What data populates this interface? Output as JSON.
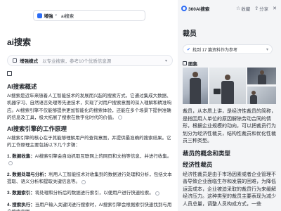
{
  "left": {
    "search": {
      "mode_label": "増強",
      "query": "ai搜索"
    },
    "page_title": "ai搜索",
    "mode": {
      "name": "增强模式",
      "description": "以专业搜索，参考10个优质信息源"
    },
    "article": {
      "h1": "AI搜索概述",
      "p1": "AI搜索是近年来随着人工智能技术的发展而兴起的搜索方式，它通过集成大数据、机器学习、自然语言处理等先进技术，实现了对用户搜索意图的深入理解和精准响应。AI搜索引擎不仅能够提供更加智能化的搜索体验，还能在多个场景下提供准确的信息及工具，极大拓展了搜索在数字化时代的价值。",
      "h2": "AI搜索引擎的工作原理",
      "p2": "AI搜索引擎的核心在于其能够理解用户的查询意图，并提供最准确的搜索结果。它的工作原理主要包括以下几个步骤：",
      "steps": [
        {
          "term": "1. 数据收集：",
          "text": "AI搜索引擎会自动抓取互联网上的网页和文档等信息，并进行收集。"
        },
        {
          "term": "2. 数据处理与分析：",
          "text": "利用人工智能技术对收集到的数据进行处理和分析，包括文本提取、语义分析和提取关键信息等。"
        },
        {
          "term": "3. 数据索引：",
          "text": "将处理和分析后的数据进行索引，以便用户进行快速检索。"
        },
        {
          "term": "4. 搜索执行：",
          "text": "当用户输入关键词进行搜索时，AI搜索引擎会根据索引快速找到与用户搜索意图"
        }
      ]
    }
  },
  "right": {
    "brand": "360AI搜索",
    "collect_label": "收藏",
    "share_label": "分享",
    "title": "裁员",
    "pages_text": "找到 17 篇资料作为参考",
    "pages_count": "17",
    "images_label": "图集",
    "intro": "裁员，从本质上讲，是经济性裁员的简称，是指因用人单位的原因解除劳动合同的情形，根据企业规模的动向，可以把裁员行为划分为经济性裁员，结构性裁员和优化性裁员三种类型。",
    "section1_title": "裁员的概念和类型",
    "section2_title": "经济性裁员",
    "section2_text": "经济性裁员是由于市场因素或者企业管理不善导致企业面临生存和发展的困难，为降低运营成本，企业被迫采取的裁员行为来缓解经济压力。这种类型的裁员主要表现为减少人员总量，调整人员构成方式，一些"
  },
  "icons": {
    "brand": "logo-icon",
    "collect": "star-icon",
    "share": "share-icon",
    "pages": "check-icon"
  }
}
